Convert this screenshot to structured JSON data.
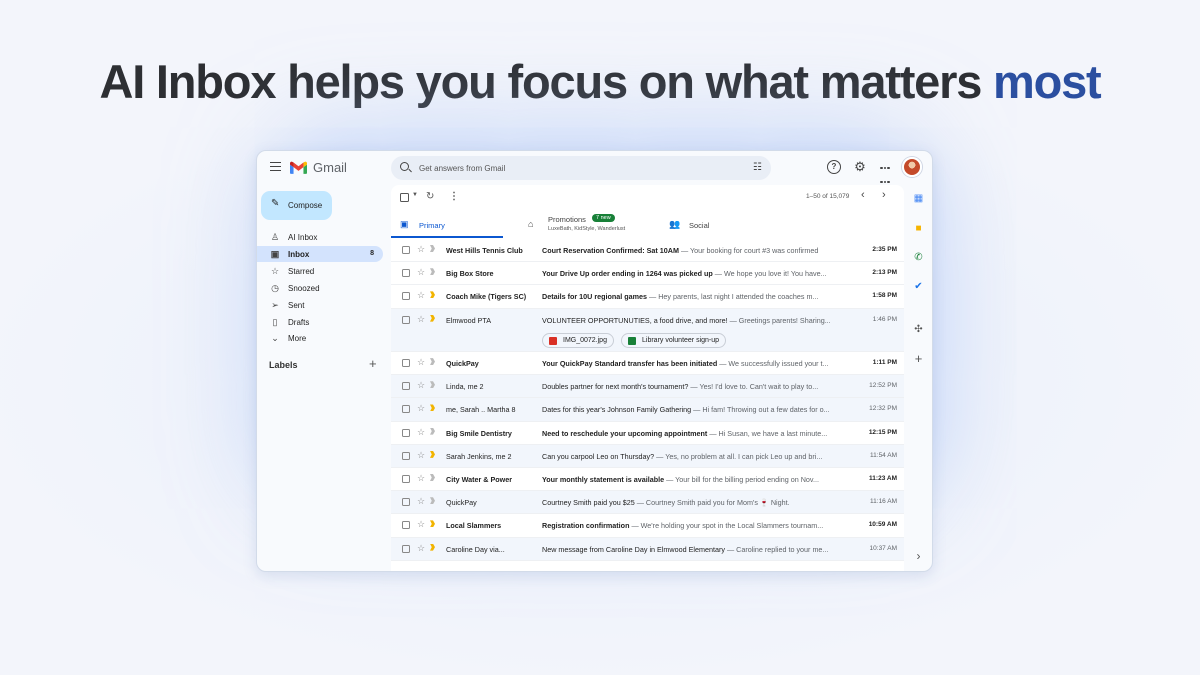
{
  "headline": {
    "main": "AI Inbox helps you focus on what matters",
    "accent": "most"
  },
  "app": {
    "brand": "Gmail",
    "search_placeholder": "Get answers from Gmail"
  },
  "sidebar": {
    "compose": "Compose",
    "items": [
      {
        "label": "AI Inbox",
        "icon": "ai-inbox-icon",
        "count": ""
      },
      {
        "label": "Inbox",
        "icon": "inbox-icon",
        "count": "8",
        "active": true
      },
      {
        "label": "Starred",
        "icon": "star-icon",
        "count": ""
      },
      {
        "label": "Snoozed",
        "icon": "clock-icon",
        "count": ""
      },
      {
        "label": "Sent",
        "icon": "send-icon",
        "count": ""
      },
      {
        "label": "Drafts",
        "icon": "draft-icon",
        "count": ""
      },
      {
        "label": "More",
        "icon": "chevron-down-icon",
        "count": ""
      }
    ],
    "labels_heading": "Labels"
  },
  "toolbar": {
    "pager": "1–50 of 15,079"
  },
  "tabs": {
    "primary": "Primary",
    "promotions": "Promotions",
    "promotions_badge": "7 new",
    "promotions_sub": "LuxeBath, KidStyle, Wanderlust",
    "social": "Social"
  },
  "emails": [
    {
      "from": "West Hills Tennis Club",
      "subject": "Court Reservation Confirmed: Sat 10AM",
      "snippet": " — Your booking for court #3 was confirmed",
      "date": "2:35 PM",
      "unread": true,
      "important": false
    },
    {
      "from": "Big Box Store",
      "subject": "Your Drive Up order ending in 1264 was picked up",
      "snippet": " — We hope you love it! You have...",
      "date": "2:13 PM",
      "unread": true,
      "important": false
    },
    {
      "from": "Coach Mike (Tigers SC)",
      "subject": "Details for 10U regional games",
      "snippet": " — Hey parents, last night I attended the coaches m...",
      "date": "1:58 PM",
      "unread": true,
      "important": true
    },
    {
      "from": "Elmwood PTA",
      "subject": "VOLUNTEER OPPORTUNUTIES, a food drive, and more!",
      "snippet": " — Greetings parents! Sharing...",
      "date": "1:46 PM",
      "unread": false,
      "important": true,
      "attachments": [
        "IMG_0072.jpg",
        "Library volunteer sign-up"
      ]
    },
    {
      "from": "QuickPay",
      "subject": "Your QuickPay Standard transfer has been initiated",
      "snippet": " — We successfully issued your t...",
      "date": "1:11 PM",
      "unread": true,
      "important": false
    },
    {
      "from": "Linda, me 2",
      "subject": "Doubles partner for next month's tournament?",
      "snippet": " — Yes! I'd love to. Can't wait to play to...",
      "date": "12:52 PM",
      "unread": false,
      "important": false
    },
    {
      "from": "me, Sarah .. Martha 8",
      "subject": "Dates for this year's Johnson Family Gathering",
      "snippet": " — Hi fam! Throwing out a few dates for o...",
      "date": "12:32 PM",
      "unread": false,
      "important": true
    },
    {
      "from": "Big Smile Dentistry",
      "subject": "Need to reschedule your upcoming appointment",
      "snippet": " — Hi Susan, we have a last minute...",
      "date": "12:15 PM",
      "unread": true,
      "important": false
    },
    {
      "from": "Sarah Jenkins, me 2",
      "subject": "Can you carpool Leo on Thursday?",
      "snippet": " — Yes, no problem at all. I can pick Leo up and bri...",
      "date": "11:54 AM",
      "unread": false,
      "important": true
    },
    {
      "from": "City Water & Power",
      "subject": "Your monthly statement is available",
      "snippet": " — Your bill for the billing period ending on Nov...",
      "date": "11:23 AM",
      "unread": true,
      "important": false
    },
    {
      "from": "QuickPay",
      "subject": "Courtney Smith paid you $25",
      "snippet": " — Courtney Smith paid you for Mom's 🍷 Night.",
      "date": "11:16 AM",
      "unread": false,
      "important": false
    },
    {
      "from": "Local Slammers",
      "subject": "Registration confirmation",
      "snippet": " — We're holding your spot in the Local Slammers tournam...",
      "date": "10:59 AM",
      "unread": true,
      "important": true
    },
    {
      "from": "Caroline Day via...",
      "subject": "New message from Caroline Day in Elmwood Elementary",
      "snippet": " — Caroline replied to your me...",
      "date": "10:37 AM",
      "unread": false,
      "important": true
    }
  ],
  "rail": [
    "calendar-icon",
    "keep-icon",
    "meet-icon",
    "tasks-icon",
    "addons-icon",
    "add-icon"
  ],
  "colors": {
    "accent": "#2b4fa0",
    "primary_tab": "#0b57d0",
    "compose_bg": "#c2e7ff",
    "active_nav": "#d3e3fd",
    "promo_badge": "#188038"
  }
}
